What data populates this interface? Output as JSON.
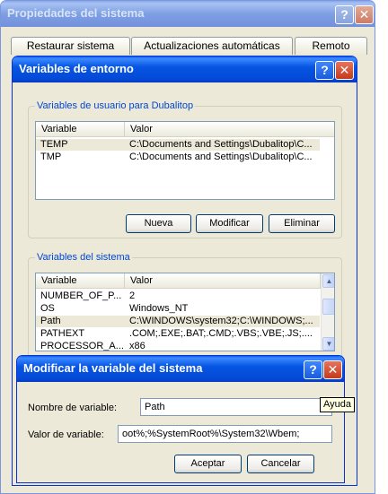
{
  "system_props": {
    "title": "Propiedades del sistema",
    "tabs": [
      "Restaurar sistema",
      "Actualizaciones automáticas",
      "Remoto"
    ]
  },
  "env_vars": {
    "title": "Variables de entorno",
    "user_group_label": "Variables de usuario para Dubalitop",
    "columns": [
      "Variable",
      "Valor"
    ],
    "user_rows": [
      {
        "variable": "TEMP",
        "valor": "C:\\Documents and Settings\\Dubalitop\\C..."
      },
      {
        "variable": "TMP",
        "valor": "C:\\Documents and Settings\\Dubalitop\\C..."
      }
    ],
    "buttons": {
      "new": "Nueva",
      "edit": "Modificar",
      "delete": "Eliminar"
    },
    "system_group_label": "Variables del sistema",
    "system_rows": [
      {
        "variable": "NUMBER_OF_P...",
        "valor": "2"
      },
      {
        "variable": "OS",
        "valor": "Windows_NT"
      },
      {
        "variable": "Path",
        "valor": "C:\\WINDOWS\\system32;C:\\WINDOWS;..."
      },
      {
        "variable": "PATHEXT",
        "valor": ".COM;.EXE;.BAT;.CMD;.VBS;.VBE;.JS;...."
      },
      {
        "variable": "PROCESSOR_A...",
        "valor": "x86"
      }
    ]
  },
  "edit_dialog": {
    "title": "Modificar la variable del sistema",
    "name_label": "Nombre de variable:",
    "name_value": "Path",
    "value_label": "Valor de variable:",
    "value_value": "oot%;%SystemRoot%\\System32\\Wbem;",
    "accept": "Aceptar",
    "cancel": "Cancelar"
  },
  "tooltip": "Ayuda",
  "icons": {
    "help": "?",
    "close": "✕",
    "arrow_up": "▲",
    "arrow_down": "▼"
  }
}
